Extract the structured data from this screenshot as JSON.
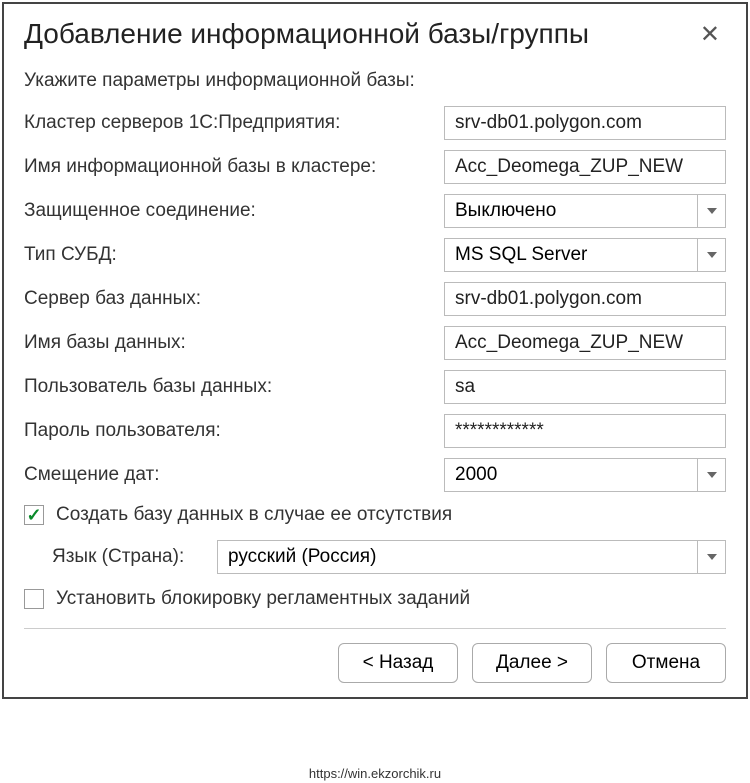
{
  "title": "Добавление информационной базы/группы",
  "subtitle": "Укажите параметры информационной базы:",
  "labels": {
    "cluster": "Кластер серверов 1С:Предприятия:",
    "ib_name": "Имя информационной базы в кластере:",
    "secure": "Защищенное соединение:",
    "dbms": "Тип СУБД:",
    "db_server": "Сервер баз данных:",
    "db_name": "Имя базы данных:",
    "db_user": "Пользователь базы данных:",
    "db_pass": "Пароль пользователя:",
    "date_offset": "Смещение дат:",
    "create_db": "Создать базу данных в случае ее отсутствия",
    "language": "Язык (Страна):",
    "lock_jobs": "Установить блокировку регламентных заданий"
  },
  "values": {
    "cluster": "srv-db01.polygon.com",
    "ib_name": "Acc_Deomega_ZUP_NEW",
    "secure": "Выключено",
    "dbms": "MS SQL Server",
    "db_server": "srv-db01.polygon.com",
    "db_name": "Acc_Deomega_ZUP_NEW",
    "db_user": "sa",
    "db_pass": "************",
    "date_offset": "2000",
    "language": "русский (Россия)"
  },
  "buttons": {
    "back": "< Назад",
    "next": "Далее >",
    "cancel": "Отмена"
  },
  "source": "https://win.ekzorchik.ru"
}
